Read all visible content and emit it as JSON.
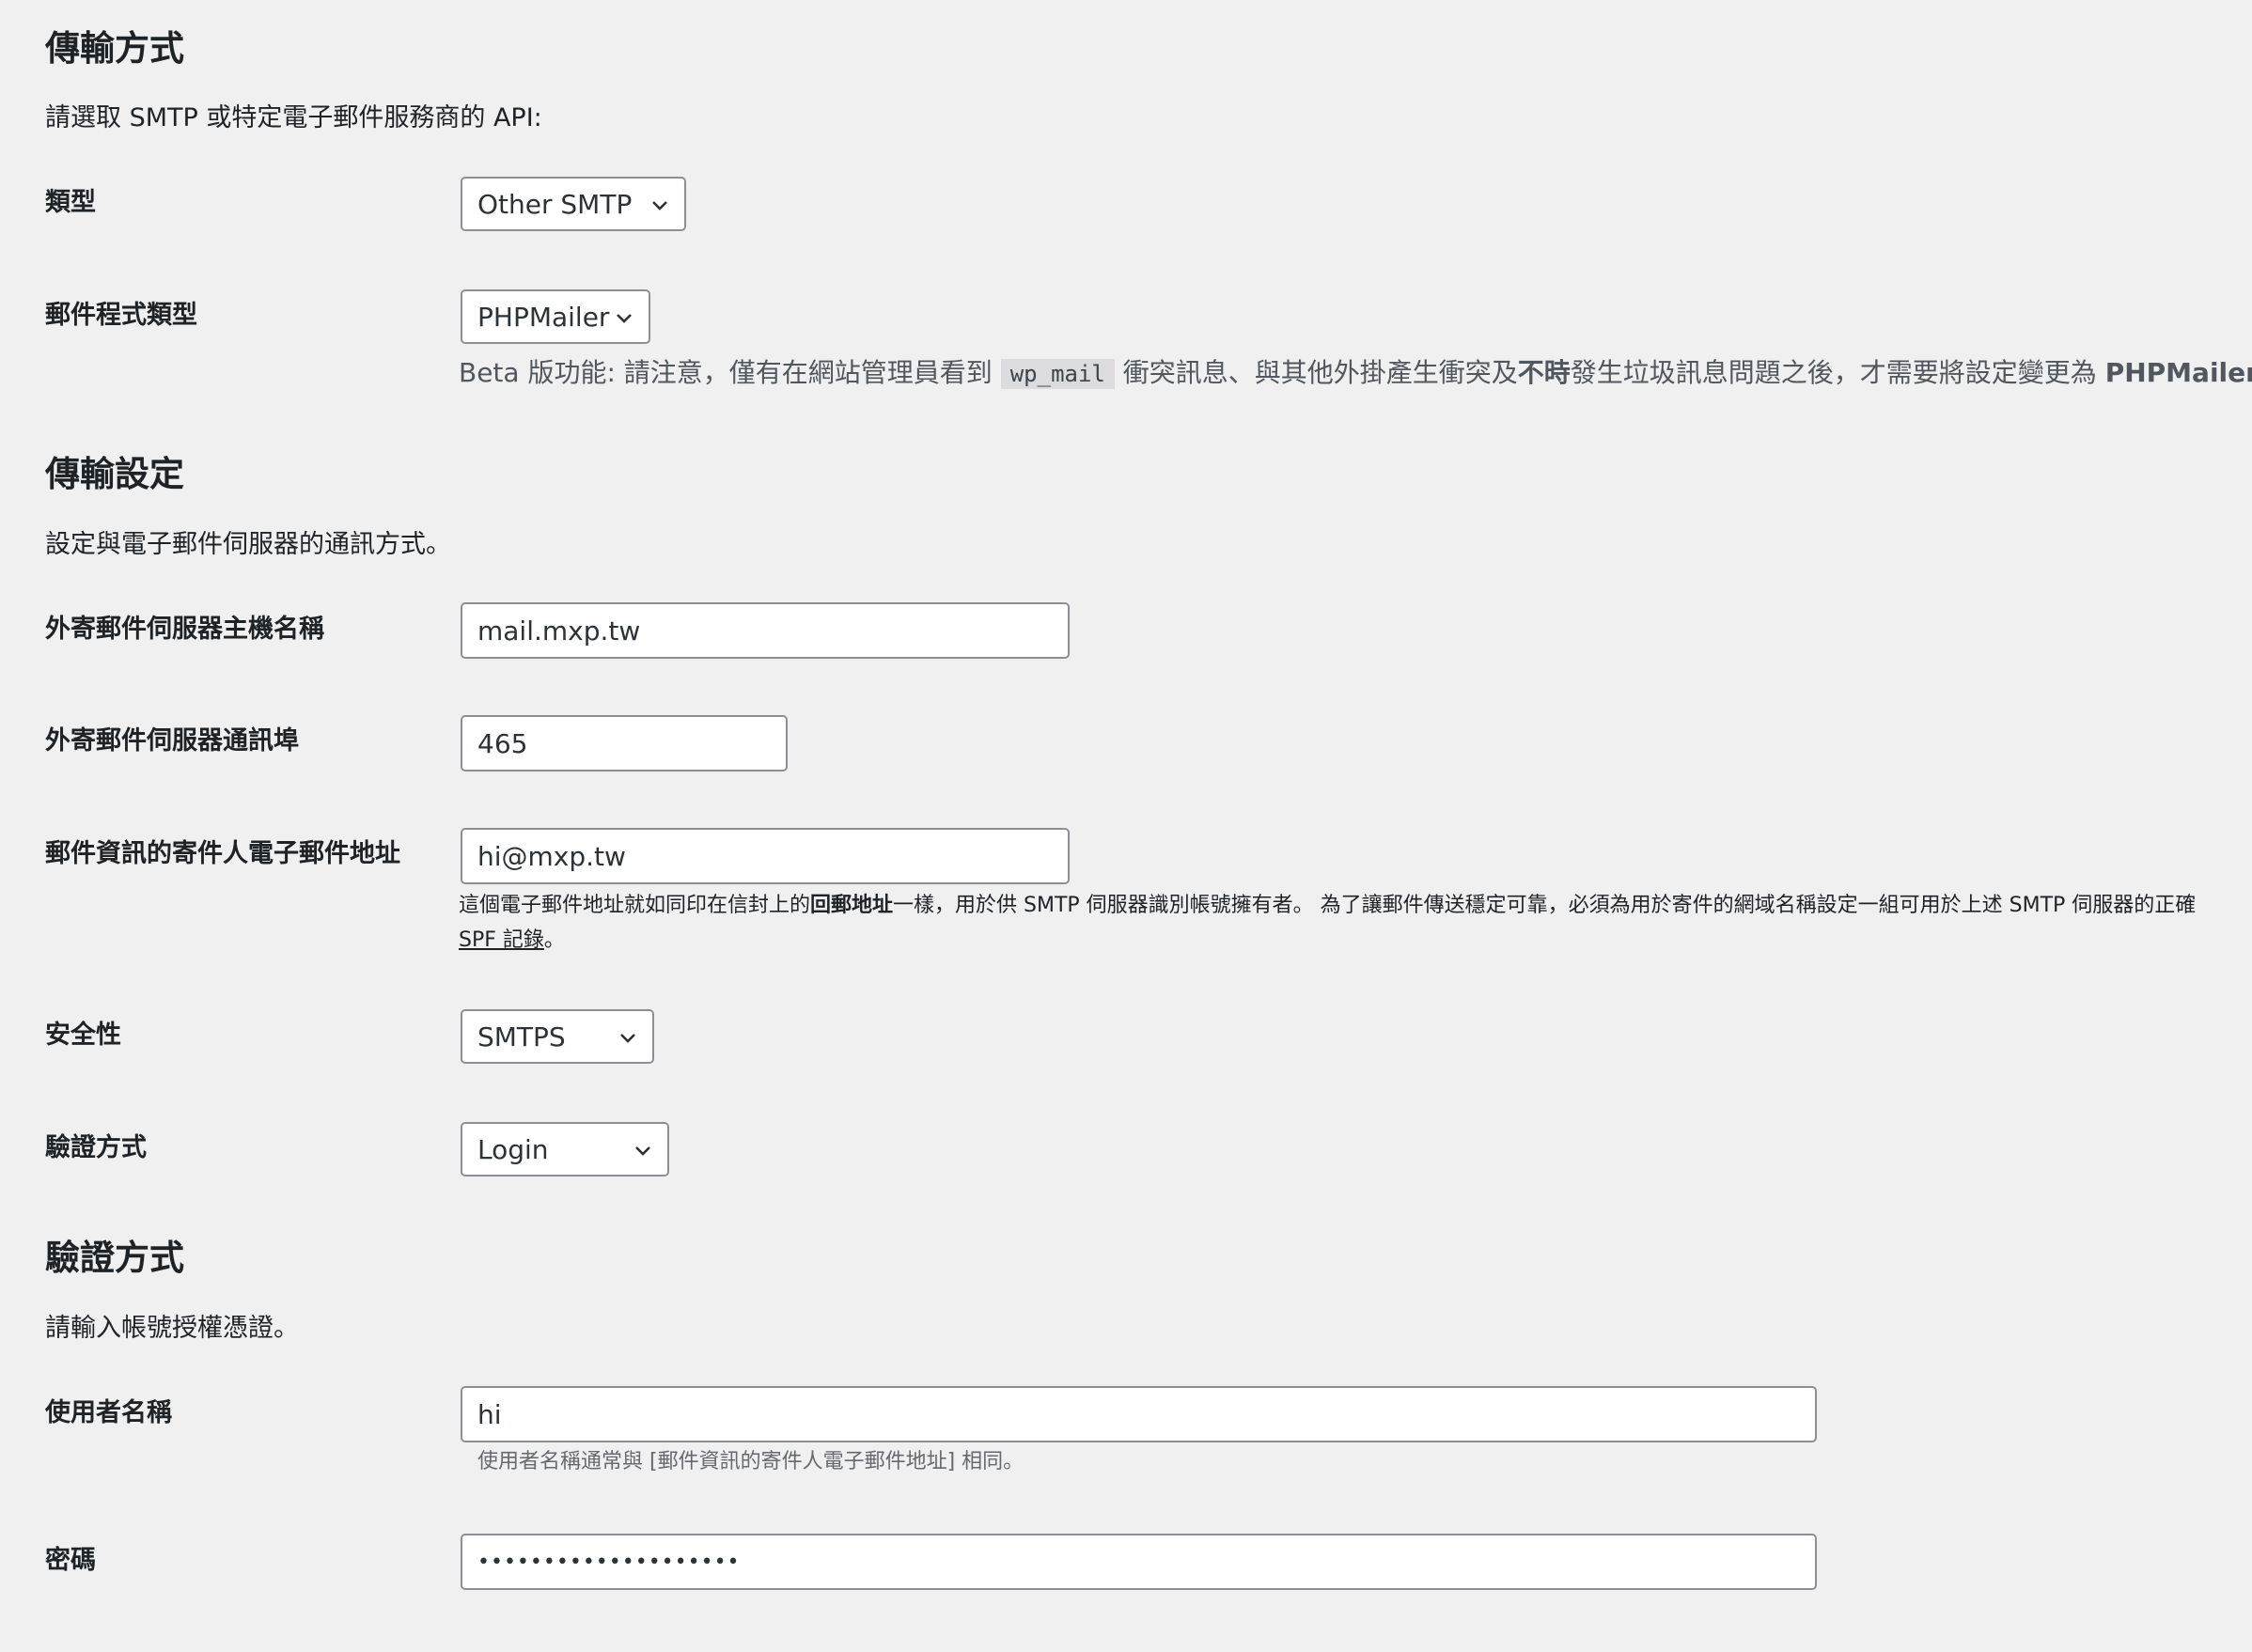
{
  "mailer": {
    "heading": "傳輸方式",
    "intro": "請選取 SMTP 或特定電子郵件服務商的 API:",
    "type_label": "類型",
    "type_value": "Other SMTP",
    "program_label": "郵件程式類型",
    "program_value": "PHPMailer",
    "beta_prefix": "Beta 版功能: 請注意，僅有在網站管理員看到 ",
    "beta_code": "wp_mail",
    "beta_mid": " 衝突訊息、與其他外掛產生衝突及",
    "beta_bold": "不時",
    "beta_mid2": "發生垃圾訊息問題之後，才需要將設定變更為 ",
    "beta_bold2": "PHPMailer",
    "beta_end": "。"
  },
  "transport": {
    "heading": "傳輸設定",
    "intro": "設定與電子郵件伺服器的通訊方式。",
    "host_label": "外寄郵件伺服器主機名稱",
    "host_value": "mail.mxp.tw",
    "port_label": "外寄郵件伺服器通訊埠",
    "port_value": "465",
    "from_label": "郵件資訊的寄件人電子郵件地址",
    "from_value": "hi@mxp.tw",
    "from_desc_1": "這個電子郵件地址就如同印在信封上的",
    "from_desc_bold": "回郵地址",
    "from_desc_2": "一樣，用於供 SMTP 伺服器識別帳號擁有者。 為了讓郵件傳送穩定可靠，必須為用於寄件的網域名稱設定一組可用於上述 SMTP 伺服器的正確",
    "from_desc_link": "SPF 記錄",
    "from_desc_end": "。",
    "security_label": "安全性",
    "security_value": "SMTPS",
    "auth_label": "驗證方式",
    "auth_value": "Login"
  },
  "auth": {
    "heading": "驗證方式",
    "intro": "請輸入帳號授權憑證。",
    "username_label": "使用者名稱",
    "username_value": "hi",
    "username_desc": "使用者名稱通常與 [郵件資訊的寄件人電子郵件地址] 相同。",
    "password_label": "密碼",
    "password_value": "••••••••••••••••••••"
  },
  "icons": {
    "select": "chevron-down-icon"
  }
}
